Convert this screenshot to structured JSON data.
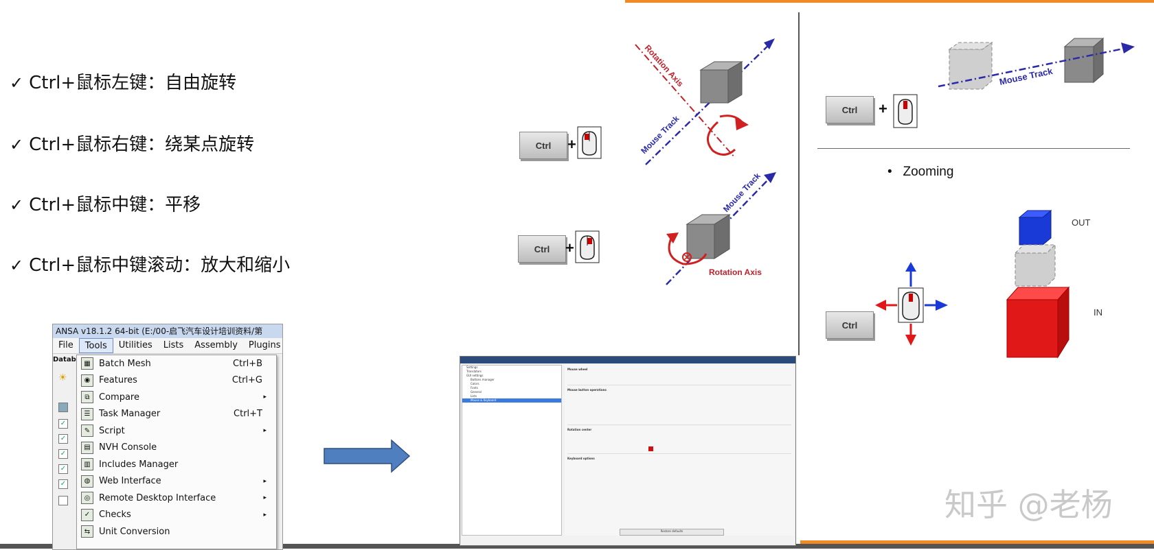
{
  "bullets": [
    {
      "check": "✓",
      "text": "Ctrl+鼠标左键：自由旋转"
    },
    {
      "check": "✓",
      "text": "Ctrl+鼠标右键：绕某点旋转"
    },
    {
      "check": "✓",
      "text": "Ctrl+鼠标中键：平移"
    },
    {
      "check": "✓",
      "text": "Ctrl+鼠标中键滚动：放大和缩小"
    }
  ],
  "diagrams": {
    "ctrl_key": "Ctrl",
    "plus": "+",
    "rotation_axis": "Rotation Axis",
    "mouse_track": "Mouse Track",
    "zoom_bullet": "•",
    "zooming": "Zooming",
    "out": "OUT",
    "in": "IN"
  },
  "ansa": {
    "title": "ANSA v18.1.2 64-bit (E:/00-启飞汽车设计培训资料/第",
    "menu": [
      "File",
      "Tools",
      "Utilities",
      "Lists",
      "Assembly",
      "Plugins"
    ],
    "active_menu": "Tools",
    "side_label": "Datab",
    "tools_menu": [
      {
        "label": "Batch Mesh",
        "shortcut": "Ctrl+B",
        "submenu": false,
        "icon": "batch-mesh-icon"
      },
      {
        "label": "Features",
        "shortcut": "Ctrl+G",
        "submenu": false,
        "icon": "features-icon"
      },
      {
        "label": "Compare",
        "shortcut": "",
        "submenu": true,
        "icon": "compare-icon"
      },
      {
        "label": "Task Manager",
        "shortcut": "Ctrl+T",
        "submenu": false,
        "icon": "task-manager-icon"
      },
      {
        "label": "Script",
        "shortcut": "",
        "submenu": true,
        "icon": "script-icon"
      },
      {
        "label": "NVH Console",
        "shortcut": "",
        "submenu": false,
        "icon": "nvh-console-icon"
      },
      {
        "label": "Includes Manager",
        "shortcut": "",
        "submenu": false,
        "icon": "includes-manager-icon"
      },
      {
        "label": "Web Interface",
        "shortcut": "",
        "submenu": true,
        "icon": "web-interface-icon"
      },
      {
        "label": "Remote Desktop Interface",
        "shortcut": "",
        "submenu": true,
        "icon": "remote-desktop-icon"
      },
      {
        "label": "Checks",
        "shortcut": "",
        "submenu": true,
        "icon": "checks-icon"
      },
      {
        "label": "Unit Conversion",
        "shortcut": "",
        "submenu": false,
        "icon": "unit-conversion-icon"
      }
    ],
    "submenu_glyph": "▸"
  },
  "dialog": {
    "nav": [
      "Settings",
      "Translators",
      "GUI settings",
      "Buttons manager",
      "Colors",
      "Fonts",
      "General",
      "Lists",
      "Mouse & Keyboard"
    ],
    "sections": [
      "Mouse wheel",
      "Mouse button operations",
      "Rotation center",
      "Keyboard options"
    ],
    "footer_button": "Restore defaults"
  },
  "watermark": "知乎 @老杨",
  "colors": {
    "accent_orange": "#f08a24",
    "track_blue": "#2a2aa8",
    "axis_red": "#c0202a",
    "arrow_blue": "#4f7fbf",
    "zoom_out_blue": "#1a3ad8",
    "zoom_in_red": "#e01818"
  }
}
